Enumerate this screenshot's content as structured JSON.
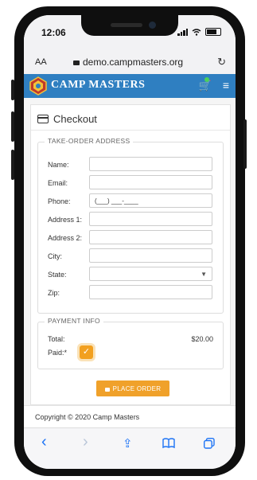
{
  "status_bar": {
    "time": "12:06"
  },
  "browser": {
    "text_size_label": "AA",
    "url": "demo.campmasters.org"
  },
  "header": {
    "brand": "CAMP MASTERS",
    "accent": "#2f7fc1"
  },
  "checkout": {
    "title": "Checkout",
    "address_section": "TAKE-ORDER ADDRESS",
    "fields": [
      {
        "label": "Name:",
        "value": ""
      },
      {
        "label": "Email:",
        "value": ""
      },
      {
        "label": "Phone:",
        "value": "(___) ___-____"
      },
      {
        "label": "Address 1:",
        "value": ""
      },
      {
        "label": "Address 2:",
        "value": ""
      },
      {
        "label": "City:",
        "value": ""
      },
      {
        "label": "State:",
        "value": ""
      },
      {
        "label": "Zip:",
        "value": ""
      }
    ],
    "payment_section": "PAYMENT INFO",
    "total_label": "Total:",
    "total_value": "$20.00",
    "paid_label": "Paid:*",
    "paid_checked": true,
    "button_label": "PLACE ORDER",
    "button_color": "#f0a12a"
  },
  "footer": {
    "copyright": "Copyright © 2020 Camp Masters"
  },
  "icons": {
    "back": "‹",
    "forward": "›",
    "share": "⇪",
    "bookmarks": "📖",
    "tabs": "⧉",
    "reload": "↻",
    "cart": "🛒",
    "menu": "≡",
    "check": "✓"
  }
}
